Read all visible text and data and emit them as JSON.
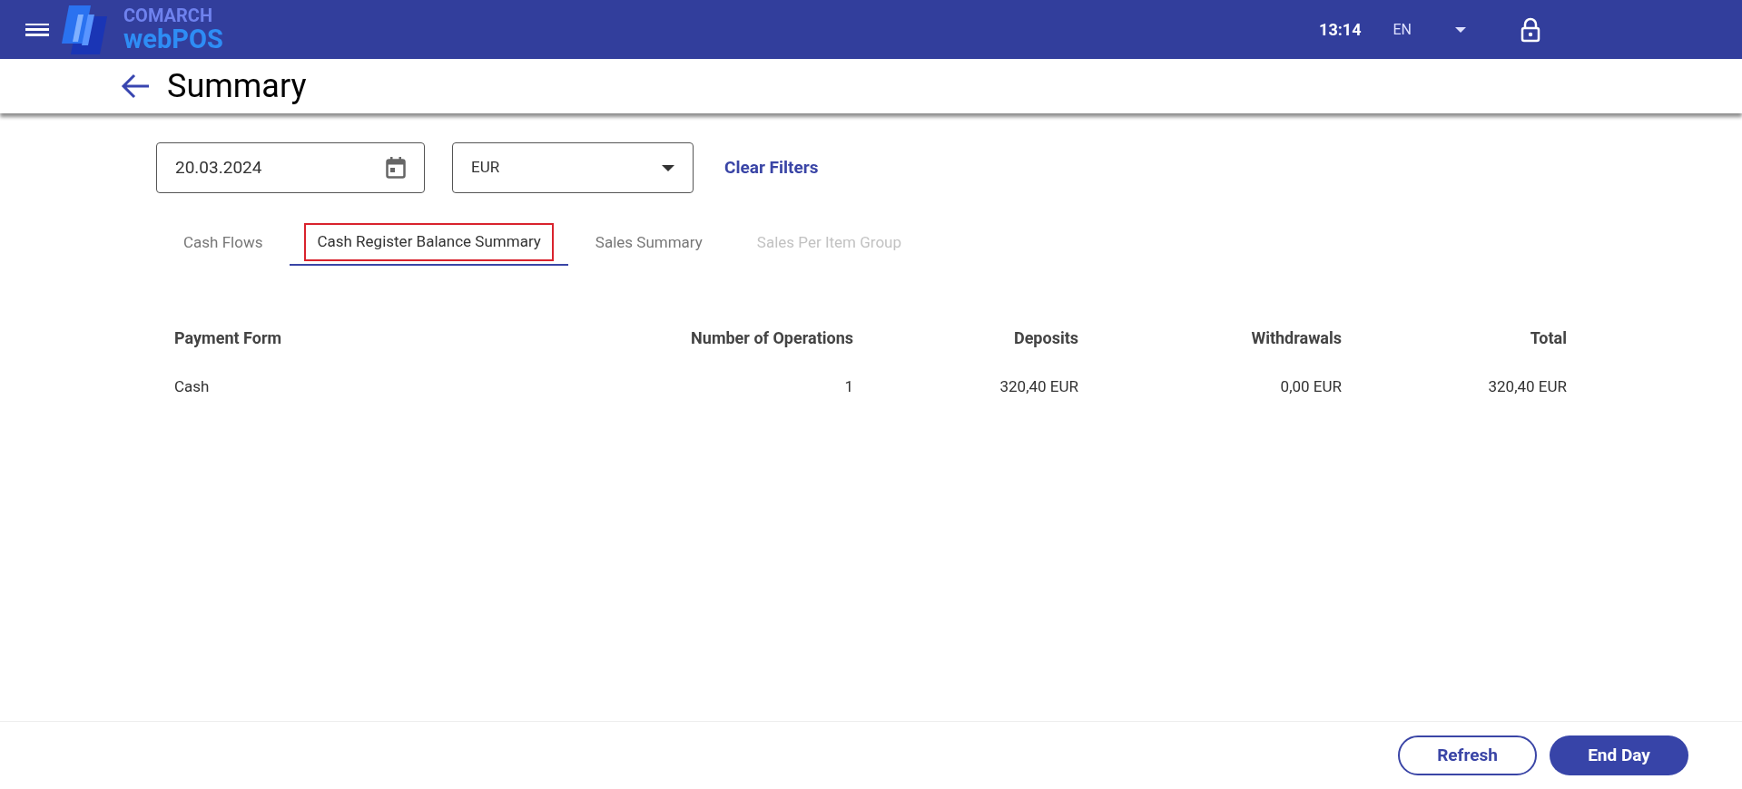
{
  "header": {
    "brand_top": "COMARCH",
    "brand_bottom": "webPOS",
    "time": "13:14",
    "language": "EN"
  },
  "title": "Summary",
  "filters": {
    "date": "20.03.2024",
    "currency": "EUR",
    "clear_label": "Clear Filters"
  },
  "tabs": [
    {
      "label": "Cash Flows",
      "selected": false,
      "disabled": false,
      "highlighted": false
    },
    {
      "label": "Cash Register Balance Summary",
      "selected": true,
      "disabled": false,
      "highlighted": true
    },
    {
      "label": "Sales Summary",
      "selected": false,
      "disabled": false,
      "highlighted": false
    },
    {
      "label": "Sales Per Item Group",
      "selected": false,
      "disabled": true,
      "highlighted": false
    }
  ],
  "table": {
    "columns": [
      "Payment Form",
      "Number of Operations",
      "Deposits",
      "Withdrawals",
      "Total"
    ],
    "rows": [
      [
        "Cash",
        "1",
        "320,40 EUR",
        "0,00 EUR",
        "320,40 EUR"
      ]
    ]
  },
  "buttons": [
    {
      "label": "Refresh",
      "kind": "outline"
    },
    {
      "label": "End Day",
      "kind": "filled"
    }
  ]
}
